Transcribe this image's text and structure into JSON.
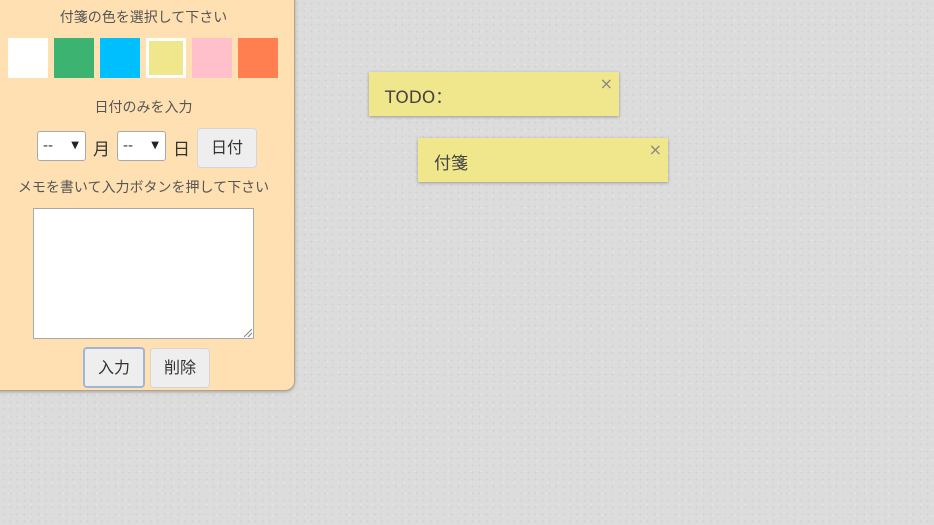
{
  "panel": {
    "color_heading": "付箋の色を選択して下さい",
    "colors": [
      {
        "name": "white",
        "hex": "#ffffff",
        "selected": false
      },
      {
        "name": "green",
        "hex": "#3cb371",
        "selected": false
      },
      {
        "name": "sky-blue",
        "hex": "#00bfff",
        "selected": false
      },
      {
        "name": "khaki",
        "hex": "#f0e68c",
        "selected": true
      },
      {
        "name": "pink",
        "hex": "#ffc0cb",
        "selected": false
      },
      {
        "name": "coral",
        "hex": "#ff7f50",
        "selected": false
      }
    ],
    "date_heading": "日付のみを入力",
    "month_value": "--",
    "month_unit": "月",
    "day_value": "--",
    "day_unit": "日",
    "date_button": "日付",
    "memo_heading": "メモを書いて入力ボタンを押して下さい",
    "memo_value": "",
    "input_button": "入力",
    "delete_button": "削除"
  },
  "notes": [
    {
      "text": "TODO：",
      "close": "×",
      "color": "#f0e68c"
    },
    {
      "text": "付箋",
      "close": "×",
      "color": "#f0e68c"
    }
  ]
}
